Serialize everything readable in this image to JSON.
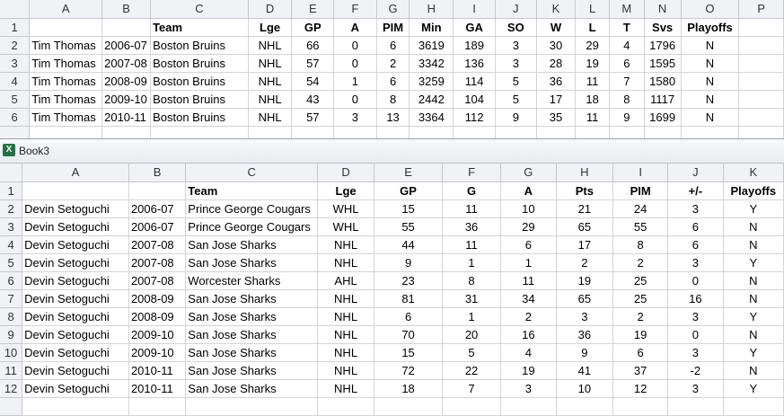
{
  "sheet1": {
    "columns": [
      "A",
      "B",
      "C",
      "D",
      "E",
      "F",
      "G",
      "H",
      "I",
      "J",
      "K",
      "L",
      "M",
      "N",
      "O",
      "P"
    ],
    "rows": [
      {
        "num": "1",
        "cells": [
          "",
          "",
          "Team",
          "Lge",
          "GP",
          "A",
          "PIM",
          "Min",
          "GA",
          "SO",
          "W",
          "L",
          "T",
          "Svs",
          "Playoffs",
          ""
        ]
      },
      {
        "num": "2",
        "cells": [
          "Tim Thomas",
          "2006-07",
          "Boston Bruins",
          "NHL",
          "66",
          "0",
          "6",
          "3619",
          "189",
          "3",
          "30",
          "29",
          "4",
          "1796",
          "N",
          ""
        ]
      },
      {
        "num": "3",
        "cells": [
          "Tim Thomas",
          "2007-08",
          "Boston Bruins",
          "NHL",
          "57",
          "0",
          "2",
          "3342",
          "136",
          "3",
          "28",
          "19",
          "6",
          "1595",
          "N",
          ""
        ]
      },
      {
        "num": "4",
        "cells": [
          "Tim Thomas",
          "2008-09",
          "Boston Bruins",
          "NHL",
          "54",
          "1",
          "6",
          "3259",
          "114",
          "5",
          "36",
          "11",
          "7",
          "1580",
          "N",
          ""
        ]
      },
      {
        "num": "5",
        "cells": [
          "Tim Thomas",
          "2009-10",
          "Boston Bruins",
          "NHL",
          "43",
          "0",
          "8",
          "2442",
          "104",
          "5",
          "17",
          "18",
          "8",
          "1117",
          "N",
          ""
        ]
      },
      {
        "num": "6",
        "cells": [
          "Tim Thomas",
          "2010-11",
          "Boston Bruins",
          "NHL",
          "57",
          "3",
          "13",
          "3364",
          "112",
          "9",
          "35",
          "11",
          "9",
          "1699",
          "N",
          ""
        ]
      }
    ]
  },
  "workbook2": {
    "title": "Book3",
    "icon": "excel-icon",
    "columns": [
      "A",
      "B",
      "C",
      "D",
      "E",
      "F",
      "G",
      "H",
      "I",
      "J",
      "K"
    ],
    "rows": [
      {
        "num": "1",
        "cells": [
          "",
          "",
          "Team",
          "Lge",
          "GP",
          "G",
          "A",
          "Pts",
          "PIM",
          "+/-",
          "Playoffs"
        ]
      },
      {
        "num": "2",
        "cells": [
          "Devin Setoguchi",
          "2006-07",
          "Prince George Cougars",
          "WHL",
          "15",
          "11",
          "10",
          "21",
          "24",
          "3",
          "Y"
        ]
      },
      {
        "num": "3",
        "cells": [
          "Devin Setoguchi",
          "2006-07",
          "Prince George Cougars",
          "WHL",
          "55",
          "36",
          "29",
          "65",
          "55",
          "6",
          "N"
        ]
      },
      {
        "num": "4",
        "cells": [
          "Devin Setoguchi",
          "2007-08",
          "San Jose Sharks",
          "NHL",
          "44",
          "11",
          "6",
          "17",
          "8",
          "6",
          "N"
        ]
      },
      {
        "num": "5",
        "cells": [
          "Devin Setoguchi",
          "2007-08",
          "San Jose Sharks",
          "NHL",
          "9",
          "1",
          "1",
          "2",
          "2",
          "3",
          "Y"
        ]
      },
      {
        "num": "6",
        "cells": [
          "Devin Setoguchi",
          "2007-08",
          "Worcester Sharks",
          "AHL",
          "23",
          "8",
          "11",
          "19",
          "25",
          "0",
          "N"
        ]
      },
      {
        "num": "7",
        "cells": [
          "Devin Setoguchi",
          "2008-09",
          "San Jose Sharks",
          "NHL",
          "81",
          "31",
          "34",
          "65",
          "25",
          "16",
          "N"
        ]
      },
      {
        "num": "8",
        "cells": [
          "Devin Setoguchi",
          "2008-09",
          "San Jose Sharks",
          "NHL",
          "6",
          "1",
          "2",
          "3",
          "2",
          "3",
          "Y"
        ]
      },
      {
        "num": "9",
        "cells": [
          "Devin Setoguchi",
          "2009-10",
          "San Jose Sharks",
          "NHL",
          "70",
          "20",
          "16",
          "36",
          "19",
          "0",
          "N"
        ]
      },
      {
        "num": "10",
        "cells": [
          "Devin Setoguchi",
          "2009-10",
          "San Jose Sharks",
          "NHL",
          "15",
          "5",
          "4",
          "9",
          "6",
          "3",
          "Y"
        ]
      },
      {
        "num": "11",
        "cells": [
          "Devin Setoguchi",
          "2010-11",
          "San Jose Sharks",
          "NHL",
          "72",
          "22",
          "19",
          "41",
          "37",
          "-2",
          "N"
        ]
      },
      {
        "num": "12",
        "cells": [
          "Devin Setoguchi",
          "2010-11",
          "San Jose Sharks",
          "NHL",
          "18",
          "7",
          "3",
          "10",
          "12",
          "3",
          "Y"
        ]
      }
    ]
  }
}
